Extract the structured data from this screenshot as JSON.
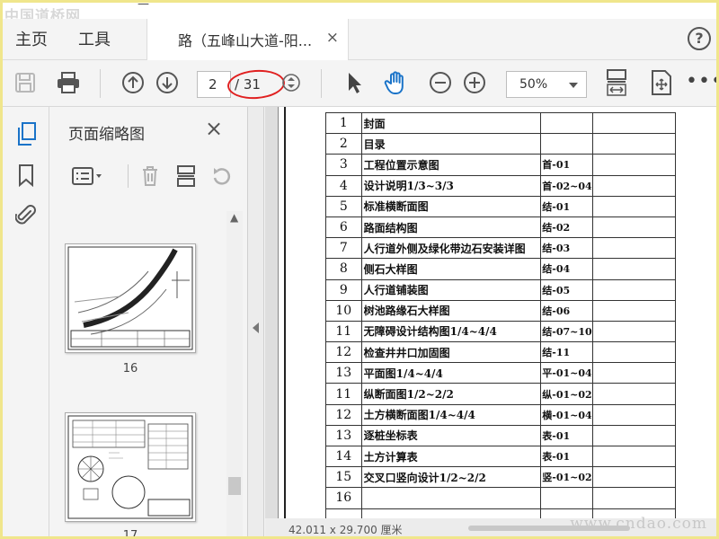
{
  "watermark_top": "中国道桥网",
  "clipped_top_text": "—",
  "menu": {
    "home": "主页",
    "tools": "工具"
  },
  "tab": {
    "title": "路（五峰山大道-阳...",
    "close": "×"
  },
  "help_icon": "?",
  "toolbar": {
    "current_page": "2",
    "total_pages": "/ 31",
    "zoom": "50%",
    "more": "•••"
  },
  "thumbnails": {
    "title": "页面缩略图",
    "close": "×",
    "pages": [
      {
        "number": "16"
      },
      {
        "number": "17"
      }
    ]
  },
  "drawing_list": {
    "rows": [
      {
        "no": "1",
        "name": "封面",
        "code": ""
      },
      {
        "no": "2",
        "name": "目录",
        "code": ""
      },
      {
        "no": "3",
        "name": "工程位置示意图",
        "code": "首-01"
      },
      {
        "no": "4",
        "name": "设计说明1/3~3/3",
        "code": "首-02~04"
      },
      {
        "no": "5",
        "name": "标准横断面图",
        "code": "结-01"
      },
      {
        "no": "6",
        "name": "路面结构图",
        "code": "结-02"
      },
      {
        "no": "7",
        "name": "人行道外侧及绿化带边石安装详图",
        "code": "结-03"
      },
      {
        "no": "8",
        "name": "侧石大样图",
        "code": "结-04"
      },
      {
        "no": "9",
        "name": "人行道铺装图",
        "code": "结-05"
      },
      {
        "no": "10",
        "name": "树池路缘石大样图",
        "code": "结-06"
      },
      {
        "no": "11",
        "name": "无障碍设计结构图1/4~4/4",
        "code": "结-07~10"
      },
      {
        "no": "12",
        "name": "检查井井口加固图",
        "code": "结-11"
      },
      {
        "no": "13",
        "name": "平面图1/4~4/4",
        "code": "平-01~04"
      },
      {
        "no": "11",
        "name": "纵断面图1/2~2/2",
        "code": "纵-01~02"
      },
      {
        "no": "12",
        "name": "土方横断面图1/4~4/4",
        "code": "横-01~04"
      },
      {
        "no": "13",
        "name": "逐桩坐标表",
        "code": "表-01"
      },
      {
        "no": "14",
        "name": "土方计算表",
        "code": "表-01"
      },
      {
        "no": "15",
        "name": "交叉口竖向设计1/2~2/2",
        "code": "竖-01~02"
      },
      {
        "no": "16",
        "name": "",
        "code": ""
      },
      {
        "no": "",
        "name": "",
        "code": ""
      }
    ]
  },
  "status": {
    "coords": "42.011 x 29.700 厘米"
  },
  "watermark_bottom": "www.cndao.com",
  "colors": {
    "highlight_ellipse": "#e02020",
    "hand_tool_active": "#1a73c8",
    "page_bg": "#ffffff"
  },
  "icons": [
    "save-icon",
    "print-icon",
    "arrow-up-icon",
    "arrow-down-icon",
    "page-stepper-icon",
    "select-arrow-icon",
    "hand-icon",
    "zoom-out-icon",
    "zoom-in-icon",
    "fit-width-icon",
    "fit-page-icon",
    "more-icon",
    "pages-icon",
    "bookmark-icon",
    "attachment-icon",
    "thumb-options-icon",
    "trash-icon",
    "crop-icon",
    "rotate-icon"
  ]
}
